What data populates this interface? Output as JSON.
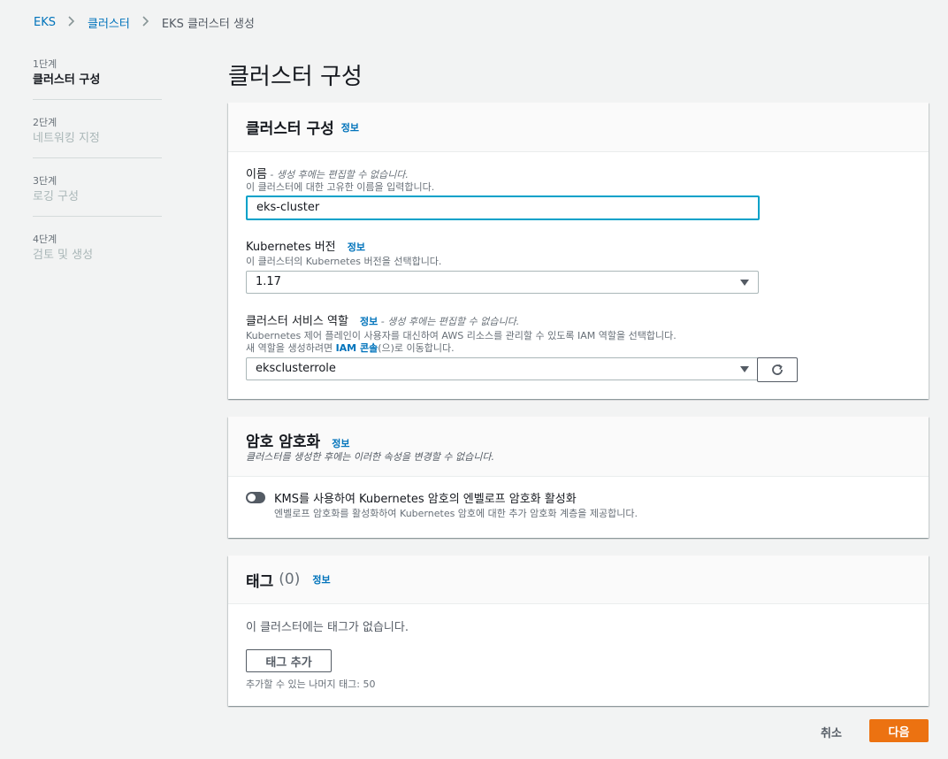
{
  "breadcrumb": {
    "items": [
      "EKS",
      "클러스터",
      "EKS 클러스터 생성"
    ]
  },
  "steps": [
    {
      "num": "1단계",
      "title": "클러스터 구성"
    },
    {
      "num": "2단계",
      "title": "네트워킹 지정"
    },
    {
      "num": "3단계",
      "title": "로깅 구성"
    },
    {
      "num": "4단계",
      "title": "검토 및 생성"
    }
  ],
  "page_title": "클러스터 구성",
  "cluster_panel": {
    "title": "클러스터 구성",
    "info": "정보",
    "name": {
      "label": "이름",
      "hint": " - 생성 후에는 편집할 수 없습니다.",
      "desc": "이 클러스터에 대한 고유한 이름을 입력합니다.",
      "value": "eks-cluster"
    },
    "version": {
      "label": "Kubernetes 버전",
      "info": "정보",
      "desc": "이 클러스터의 Kubernetes 버전을 선택합니다.",
      "value": "1.17"
    },
    "role": {
      "label": "클러스터 서비스 역할",
      "info": "정보",
      "hint": " - 생성 후에는 편집할 수 없습니다.",
      "desc1": "Kubernetes 제어 플레인이 사용자를 대신하여 AWS 리소스를 관리할 수 있도록 IAM 역할을 선택합니다.",
      "desc2_pre": "새 역할을 생성하려면 ",
      "desc2_link": "IAM 콘솔",
      "desc2_post": "(으)로 이동합니다.",
      "value": "eksclusterrole"
    }
  },
  "encryption_panel": {
    "title": "암호 암호화",
    "info": "정보",
    "subtitle": "클러스터를 생성한 후에는 이러한 속성을 변경할 수 없습니다.",
    "toggle_label": "KMS를 사용하여 Kubernetes 암호의 엔벨로프 암호화 활성화",
    "toggle_desc": "엔벨로프 암호화를 활성화하여 Kubernetes 암호에 대한 추가 암호화 계층을 제공합니다.",
    "toggle_on": false
  },
  "tags_panel": {
    "title": "태그",
    "count": "(0)",
    "info": "정보",
    "empty": "이 클러스터에는 태그가 없습니다.",
    "add_button": "태그 추가",
    "remaining": "추가할 수 있는 나머지 태그: 50"
  },
  "footer": {
    "cancel": "취소",
    "next": "다음"
  },
  "colors": {
    "accent": "#0073bb",
    "primary_button": "#ec7211",
    "focus": "#00a1c9"
  }
}
